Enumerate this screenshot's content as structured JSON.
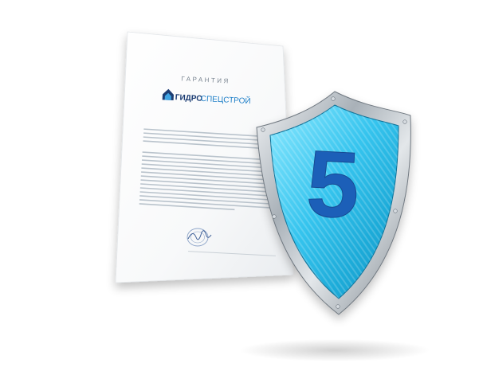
{
  "document": {
    "heading": "ГАРАНТИЯ",
    "logo_text_bold": "ГИДРО",
    "logo_text_regular": "СПЕЦСТРОЙ",
    "signature_present": true
  },
  "shield": {
    "number": "5",
    "colors": {
      "rim": "#b9c0c6",
      "face_light": "#7fe3ff",
      "face_dark": "#0aa9d8",
      "digit": "#1f5fb8"
    }
  },
  "colors": {
    "background": "#ffffff",
    "paper": "#fdfdfd",
    "logo_blue": "#1f7fc8",
    "logo_dark": "#1b3c73"
  }
}
